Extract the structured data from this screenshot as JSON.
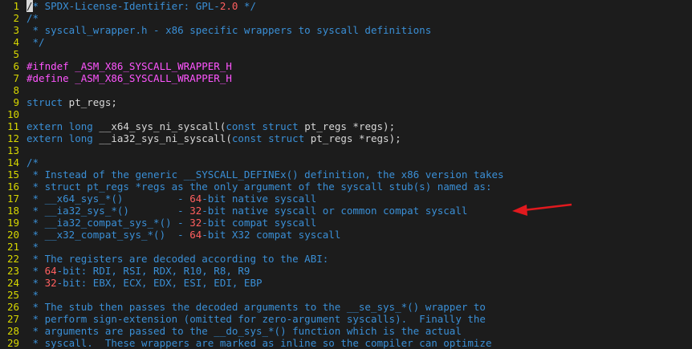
{
  "editor": {
    "lines": [
      {
        "n": "1",
        "tokens": [
          {
            "t": "/",
            "c": "cursor"
          },
          {
            "t": "* SPDX-License-Identifier: GPL-",
            "c": "comment"
          },
          {
            "t": "2.0",
            "c": "num"
          },
          {
            "t": " */",
            "c": "comment"
          }
        ]
      },
      {
        "n": "2",
        "tokens": [
          {
            "t": "/*",
            "c": "comment"
          }
        ]
      },
      {
        "n": "3",
        "tokens": [
          {
            "t": " * syscall_wrapper.h - x86 specific wrappers to syscall definitions",
            "c": "comment"
          }
        ]
      },
      {
        "n": "4",
        "tokens": [
          {
            "t": " */",
            "c": "comment"
          }
        ]
      },
      {
        "n": "5",
        "tokens": []
      },
      {
        "n": "6",
        "tokens": [
          {
            "t": "#ifndef _ASM_X86_SYSCALL_WRAPPER_H",
            "c": "pre"
          }
        ]
      },
      {
        "n": "7",
        "tokens": [
          {
            "t": "#define _ASM_X86_SYSCALL_WRAPPER_H",
            "c": "pre"
          }
        ]
      },
      {
        "n": "8",
        "tokens": []
      },
      {
        "n": "9",
        "tokens": [
          {
            "t": "struct",
            "c": "kw"
          },
          {
            "t": " pt_regs;",
            "c": "plain"
          }
        ]
      },
      {
        "n": "10",
        "tokens": []
      },
      {
        "n": "11",
        "tokens": [
          {
            "t": "extern",
            "c": "kw"
          },
          {
            "t": " ",
            "c": "plain"
          },
          {
            "t": "long",
            "c": "kw"
          },
          {
            "t": " __x64_sys_ni_syscall(",
            "c": "plain"
          },
          {
            "t": "const",
            "c": "kw"
          },
          {
            "t": " ",
            "c": "plain"
          },
          {
            "t": "struct",
            "c": "kw"
          },
          {
            "t": " pt_regs *regs);",
            "c": "plain"
          }
        ]
      },
      {
        "n": "12",
        "tokens": [
          {
            "t": "extern",
            "c": "kw"
          },
          {
            "t": " ",
            "c": "plain"
          },
          {
            "t": "long",
            "c": "kw"
          },
          {
            "t": " __ia32_sys_ni_syscall(",
            "c": "plain"
          },
          {
            "t": "const",
            "c": "kw"
          },
          {
            "t": " ",
            "c": "plain"
          },
          {
            "t": "struct",
            "c": "kw"
          },
          {
            "t": " pt_regs *regs);",
            "c": "plain"
          }
        ]
      },
      {
        "n": "13",
        "tokens": []
      },
      {
        "n": "14",
        "tokens": [
          {
            "t": "/*",
            "c": "comment"
          }
        ]
      },
      {
        "n": "15",
        "tokens": [
          {
            "t": " * Instead of the generic __SYSCALL_DEFINEx() definition, the x86 version takes",
            "c": "comment"
          }
        ]
      },
      {
        "n": "16",
        "tokens": [
          {
            "t": " * struct pt_regs *regs as the only argument of the syscall stub(s) named as:",
            "c": "comment"
          }
        ]
      },
      {
        "n": "17",
        "tokens": [
          {
            "t": " * __x64_sys_*()         - ",
            "c": "comment"
          },
          {
            "t": "64",
            "c": "num"
          },
          {
            "t": "-bit native syscall",
            "c": "comment"
          }
        ]
      },
      {
        "n": "18",
        "tokens": [
          {
            "t": " * __ia32_sys_*()        - ",
            "c": "comment"
          },
          {
            "t": "32",
            "c": "num"
          },
          {
            "t": "-bit native syscall or common compat syscall",
            "c": "comment"
          }
        ]
      },
      {
        "n": "19",
        "tokens": [
          {
            "t": " * __ia32_compat_sys_*() - ",
            "c": "comment"
          },
          {
            "t": "32",
            "c": "num"
          },
          {
            "t": "-bit compat syscall",
            "c": "comment"
          }
        ]
      },
      {
        "n": "20",
        "tokens": [
          {
            "t": " * __x32_compat_sys_*()  - ",
            "c": "comment"
          },
          {
            "t": "64",
            "c": "num"
          },
          {
            "t": "-bit X32 compat syscall",
            "c": "comment"
          }
        ]
      },
      {
        "n": "21",
        "tokens": [
          {
            "t": " *",
            "c": "comment"
          }
        ]
      },
      {
        "n": "22",
        "tokens": [
          {
            "t": " * The registers are decoded according to the ABI:",
            "c": "comment"
          }
        ]
      },
      {
        "n": "23",
        "tokens": [
          {
            "t": " * ",
            "c": "comment"
          },
          {
            "t": "64",
            "c": "num"
          },
          {
            "t": "-bit: RDI, RSI, RDX, R10, R8, R9",
            "c": "comment"
          }
        ]
      },
      {
        "n": "24",
        "tokens": [
          {
            "t": " * ",
            "c": "comment"
          },
          {
            "t": "32",
            "c": "num"
          },
          {
            "t": "-bit: EBX, ECX, EDX, ESI, EDI, EBP",
            "c": "comment"
          }
        ]
      },
      {
        "n": "25",
        "tokens": [
          {
            "t": " *",
            "c": "comment"
          }
        ]
      },
      {
        "n": "26",
        "tokens": [
          {
            "t": " * The stub then passes the decoded arguments to the __se_sys_*() wrapper to",
            "c": "comment"
          }
        ]
      },
      {
        "n": "27",
        "tokens": [
          {
            "t": " * perform sign-extension (omitted for zero-argument syscalls).  Finally the",
            "c": "comment"
          }
        ]
      },
      {
        "n": "28",
        "tokens": [
          {
            "t": " * arguments are passed to the __do_sys_*() function which is the actual",
            "c": "comment"
          }
        ]
      },
      {
        "n": "29",
        "tokens": [
          {
            "t": " * syscall.  These wrappers are marked as inline so the compiler can optimize",
            "c": "comment"
          }
        ]
      }
    ]
  },
  "annotation": {
    "arrow_color": "#e0191e",
    "points_to_line": "18"
  },
  "colors": {
    "background": "#1c1c1c",
    "line_number": "#d7d700",
    "comment": "#3a8fd6",
    "number": "#ff5f5f",
    "preprocessor": "#ff55ff",
    "keyword": "#3a8fd6",
    "plain": "#d8d8d8"
  }
}
